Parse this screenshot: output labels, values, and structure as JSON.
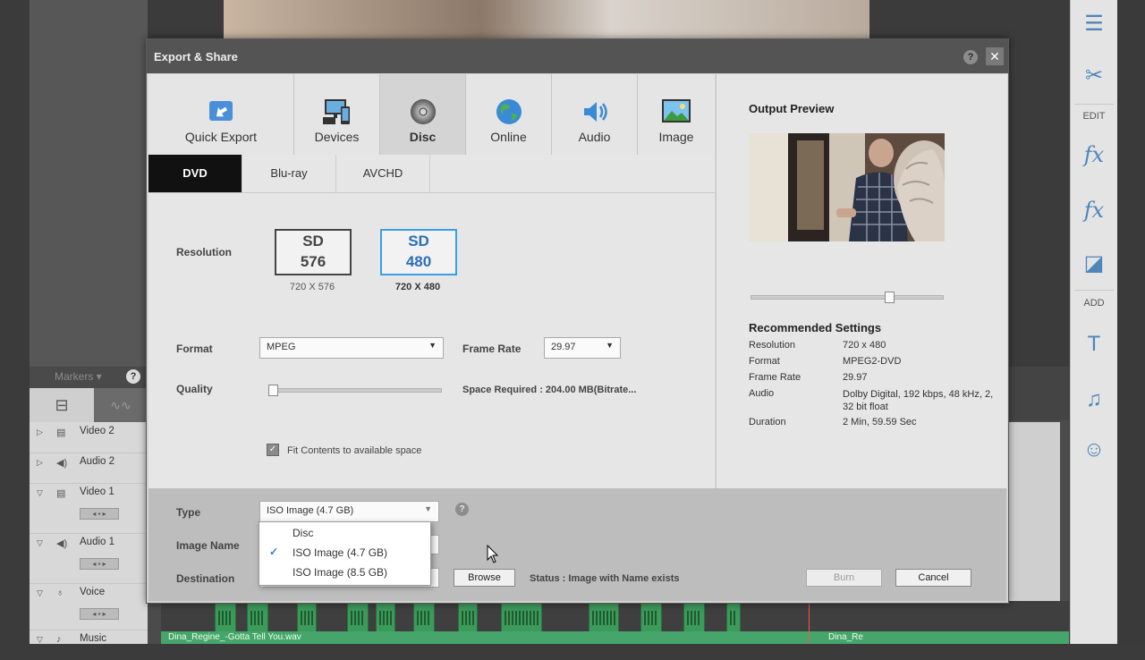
{
  "background_app": {
    "markers_label": "Markers",
    "tracks": [
      {
        "name": "Video 2",
        "icon": "film-icon"
      },
      {
        "name": "Audio 2",
        "icon": "speaker-icon"
      },
      {
        "name": "Video 1",
        "icon": "film-icon"
      },
      {
        "name": "Audio 1",
        "icon": "speaker-icon"
      },
      {
        "name": "Voice",
        "icon": "microphone-icon"
      },
      {
        "name": "Music",
        "icon": "note-icon"
      }
    ],
    "right_bar": {
      "edit_label": "EDIT",
      "add_label": "ADD",
      "fx_label": "fx"
    },
    "music_clip": "Dina_Regine_-Gotta Tell You.wav",
    "music_clip_2": "Dina_Re"
  },
  "dialog": {
    "title": "Export & Share",
    "help_glyph": "?",
    "close_glyph": "✕",
    "tabs": [
      {
        "label": "Quick Export",
        "icon": "quick-export-icon"
      },
      {
        "label": "Devices",
        "icon": "devices-icon"
      },
      {
        "label": "Disc",
        "icon": "disc-icon",
        "active": true
      },
      {
        "label": "Online",
        "icon": "globe-icon"
      },
      {
        "label": "Audio",
        "icon": "audio-icon"
      },
      {
        "label": "Image",
        "icon": "image-icon"
      }
    ],
    "subtabs": [
      {
        "label": "DVD",
        "active": true
      },
      {
        "label": "Blu-ray"
      },
      {
        "label": "AVCHD"
      }
    ],
    "settings": {
      "resolution_label": "Resolution",
      "res_options": [
        {
          "line1": "SD",
          "line2": "576",
          "caption": "720 X 576",
          "selected": false
        },
        {
          "line1": "SD",
          "line2": "480",
          "caption": "720 X 480",
          "selected": true
        }
      ],
      "format_label": "Format",
      "format_value": "MPEG",
      "frame_rate_label": "Frame Rate",
      "frame_rate_value": "29.97",
      "quality_label": "Quality",
      "space_required": "Space Required : 204.00 MB(Bitrate...",
      "fit_label": "Fit Contents to available space",
      "fit_checked": true
    },
    "output": {
      "preview_title": "Output Preview",
      "recommended_title": "Recommended Settings",
      "rows": [
        {
          "key": "Resolution",
          "value": "720 x 480"
        },
        {
          "key": "Format",
          "value": "MPEG2-DVD"
        },
        {
          "key": "Frame Rate",
          "value": "29.97"
        },
        {
          "key": "Audio",
          "value": "Dolby Digital, 192 kbps, 48 kHz, 2, 32 bit float"
        },
        {
          "key": "Duration",
          "value": "2 Min, 59.59 Sec"
        }
      ]
    },
    "bottom": {
      "type_label": "Type",
      "type_value": "ISO Image (4.7 GB)",
      "image_name_label": "Image Name",
      "destination_label": "Destination",
      "browse_label": "Browse",
      "status_text": "Status :  Image with Name exists",
      "burn_label": "Burn",
      "cancel_label": "Cancel"
    },
    "dropdown": {
      "options": [
        {
          "label": "Disc",
          "checked": false
        },
        {
          "label": "ISO Image (4.7 GB)",
          "checked": true
        },
        {
          "label": "ISO Image (8.5 GB)",
          "checked": false
        }
      ],
      "check_glyph": "✓"
    }
  }
}
